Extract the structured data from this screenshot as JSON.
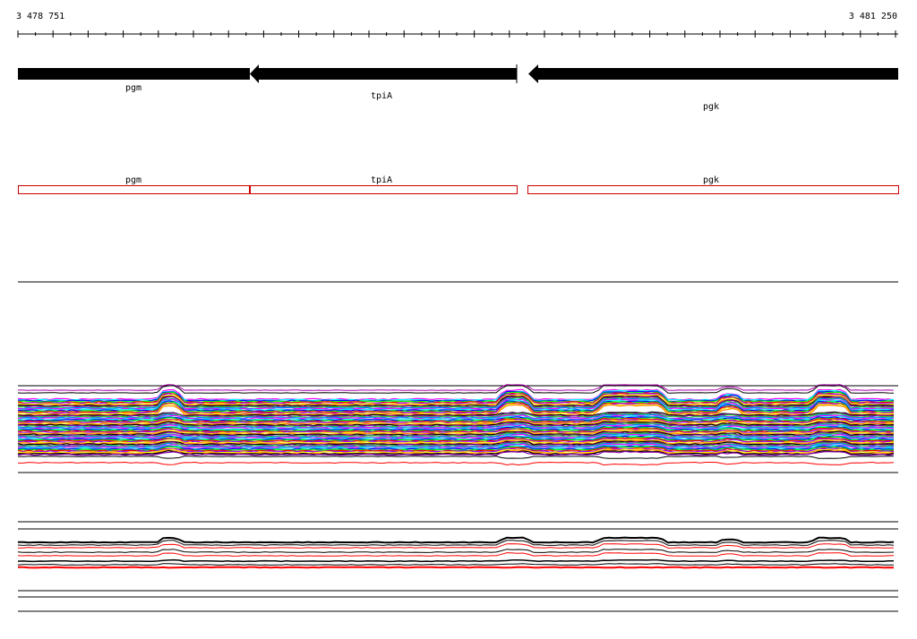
{
  "ruler": {
    "start_label": "3 478 751",
    "end_label": "3 481 250"
  },
  "genes": [
    {
      "name": "pgm",
      "strand": "-"
    },
    {
      "name": "tpiA",
      "strand": "-"
    },
    {
      "name": "pgk",
      "strand": "-"
    }
  ],
  "annotations": [
    {
      "name": "pgm"
    },
    {
      "name": "tpiA"
    },
    {
      "name": "pgk"
    }
  ],
  "colors": {
    "gene_fill": "#000000",
    "annotation_stroke": "#cc0000",
    "track_line": "#000000",
    "highlight_series": "#ff0000"
  },
  "track_palette": [
    "#ff00ff",
    "#00ffff",
    "#0000ff",
    "#00ff00",
    "#ff0000",
    "#9900ff",
    "#ffff00",
    "#ff8800",
    "#000000",
    "#8800aa",
    "#33cc33",
    "#0088ff"
  ]
}
